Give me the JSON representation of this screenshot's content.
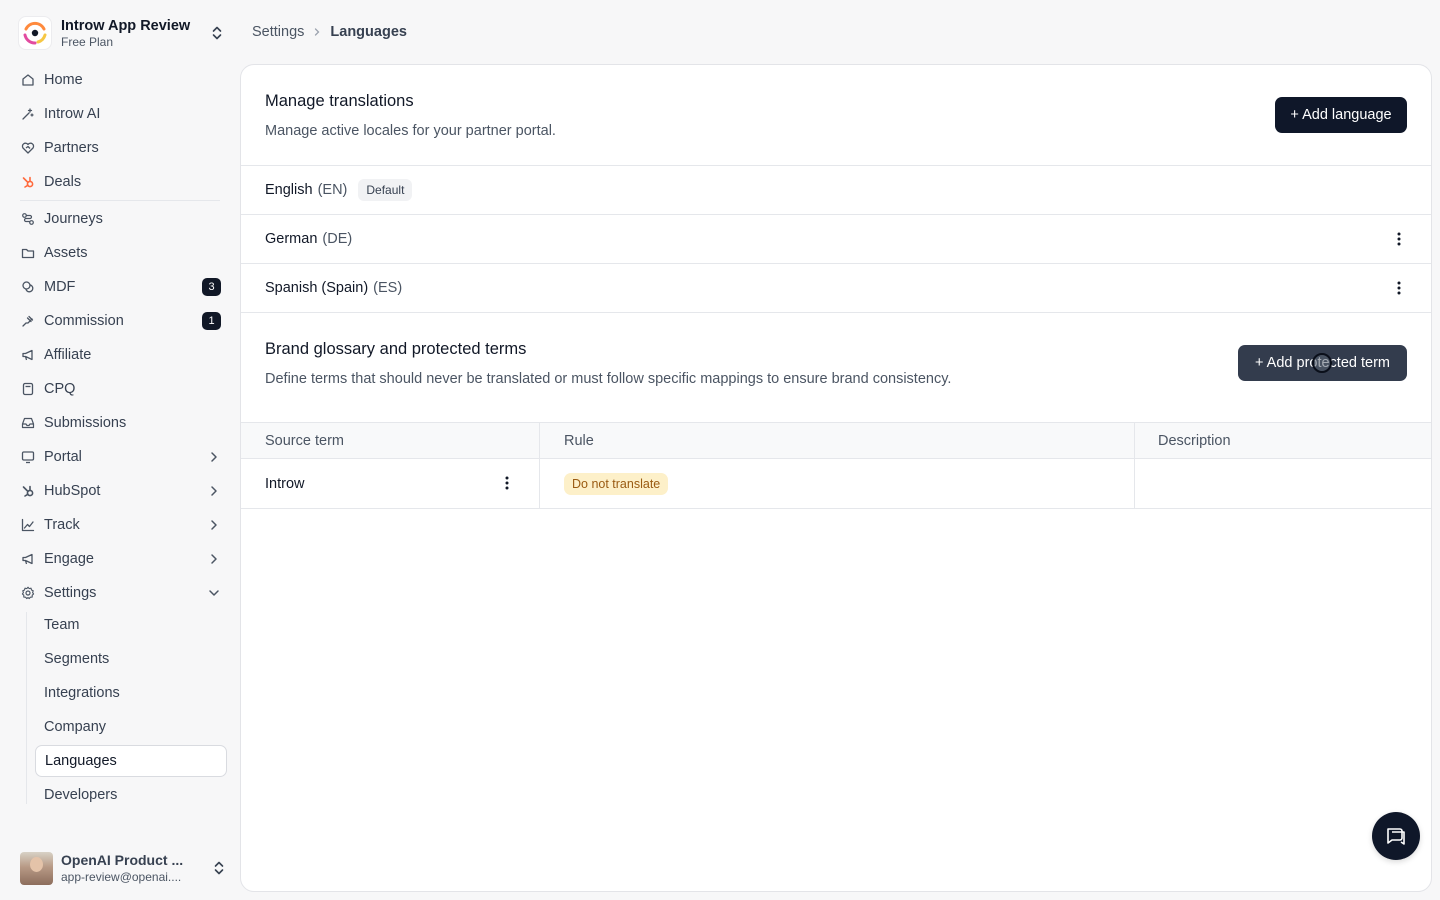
{
  "workspace": {
    "name": "Introw App Review",
    "plan": "Free Plan"
  },
  "sidebar": {
    "items": [
      {
        "label": "Home",
        "icon": "home-icon"
      },
      {
        "label": "Introw AI",
        "icon": "sparkle-icon"
      },
      {
        "label": "Partners",
        "icon": "handshake-icon"
      },
      {
        "label": "Deals",
        "icon": "hubspot-icon"
      },
      {
        "label": "Journeys",
        "icon": "workflow-icon"
      },
      {
        "label": "Assets",
        "icon": "folder-icon"
      },
      {
        "label": "MDF",
        "icon": "coins-icon",
        "badge": "3"
      },
      {
        "label": "Commission",
        "icon": "money-hand-icon",
        "badge": "1"
      },
      {
        "label": "Affiliate",
        "icon": "megaphone-icon"
      },
      {
        "label": "CPQ",
        "icon": "calculator-icon"
      },
      {
        "label": "Submissions",
        "icon": "inbox-icon"
      },
      {
        "label": "Portal",
        "icon": "monitor-icon"
      },
      {
        "label": "HubSpot",
        "icon": "hubspot-icon"
      },
      {
        "label": "Track",
        "icon": "chart-icon"
      },
      {
        "label": "Engage",
        "icon": "megaphone-icon"
      },
      {
        "label": "Settings",
        "icon": "gear-icon"
      }
    ],
    "settings_sub": [
      "Team",
      "Segments",
      "Integrations",
      "Company",
      "Languages",
      "Developers"
    ],
    "accent_color": "#ff6a3d"
  },
  "user": {
    "name": "OpenAI Product ...",
    "email": "app-review@openai...."
  },
  "breadcrumb": {
    "parent": "Settings",
    "current": "Languages"
  },
  "translations": {
    "title": "Manage translations",
    "description": "Manage active locales for your partner portal.",
    "add_button": "+ Add language",
    "languages": [
      {
        "name": "English",
        "code": "(EN)",
        "badge": "Default"
      },
      {
        "name": "German",
        "code": "(DE)"
      },
      {
        "name": "Spanish (Spain)",
        "code": "(ES)"
      }
    ]
  },
  "glossary": {
    "title": "Brand glossary and protected terms",
    "description": "Define terms that should never be translated or must follow specific mappings to ensure brand consistency.",
    "add_button": "+ Add protected term",
    "columns": [
      "Source term",
      "Rule",
      "Description"
    ],
    "rows": [
      {
        "source": "Introw",
        "rule": "Do not translate",
        "description": ""
      }
    ]
  },
  "colors": {
    "primary_button": "#0f1729",
    "rule_badge_bg": "#fdf0c9",
    "rule_badge_text": "#9a5b12"
  }
}
